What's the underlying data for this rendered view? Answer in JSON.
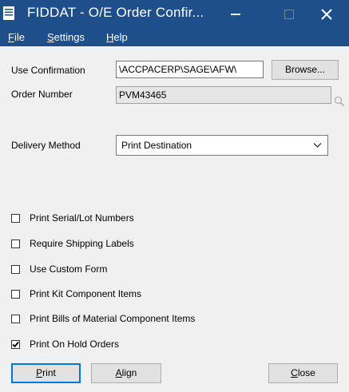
{
  "window": {
    "title": "FIDDAT - O/E Order Confir...",
    "controls": {
      "minimize": "minimize",
      "maximize": "maximize",
      "close": "close"
    }
  },
  "menu": [
    {
      "key": "F",
      "rest": "ile"
    },
    {
      "key": "S",
      "rest": "ettings"
    },
    {
      "key": "H",
      "rest": "elp"
    }
  ],
  "form": {
    "use_confirmation_label": "Use Confirmation",
    "use_confirmation_value": "\\ACCPACERP\\SAGE\\AFW\\",
    "browse_label": "Browse...",
    "order_number_label": "Order Number",
    "order_number_value": "PVM43465",
    "delivery_method_label": "Delivery Method",
    "delivery_method_value": "Print Destination"
  },
  "checkboxes": [
    {
      "label": "Print Serial/Lot Numbers",
      "checked": false
    },
    {
      "label": "Require Shipping Labels",
      "checked": false
    },
    {
      "label": "Use Custom Form",
      "checked": false
    },
    {
      "label": "Print Kit Component Items",
      "checked": false
    },
    {
      "label": "Print Bills of Material Component Items",
      "checked": false
    },
    {
      "label": "Print On Hold Orders",
      "checked": true
    }
  ],
  "buttons": {
    "print": {
      "key": "P",
      "rest": "rint"
    },
    "align": {
      "key": "A",
      "rest": "lign"
    },
    "close": {
      "key": "C",
      "rest": "lose"
    }
  },
  "colors": {
    "titlebar": "#1f4f8b",
    "window_bg": "#f0f0f0",
    "field_readonly": "#e6e6e6"
  }
}
